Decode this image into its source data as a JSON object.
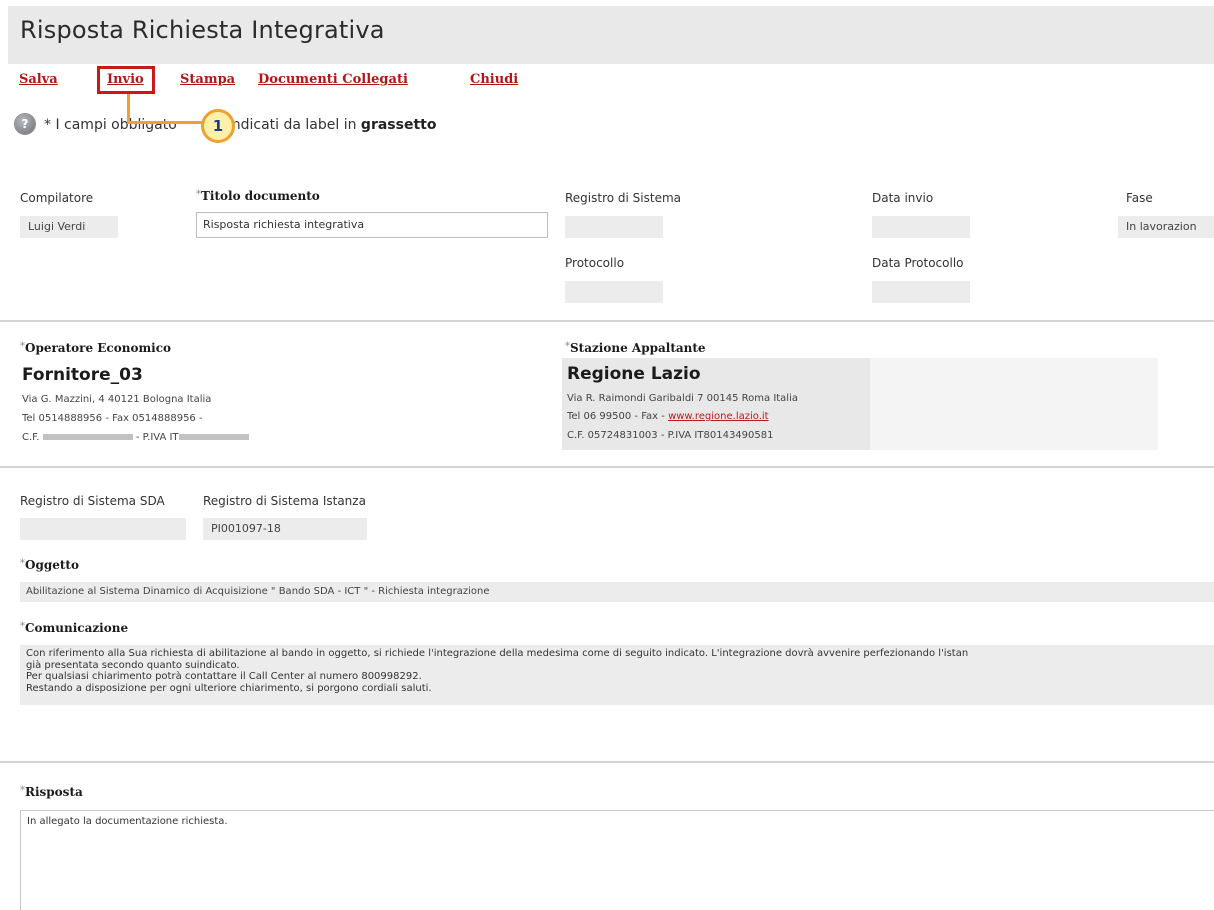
{
  "header": {
    "title": "Risposta Richiesta Integrativa"
  },
  "toolbar": {
    "salva": "Salva",
    "invio": "Invio",
    "stampa": "Stampa",
    "documenti_collegati": "Documenti Collegati",
    "chiudi": "Chiudi"
  },
  "callout": {
    "number": "1"
  },
  "help": {
    "icon": "?"
  },
  "note": {
    "prefix": "* I campi obbligato",
    "hidden_part": "",
    "suffix": "o indicati da label in",
    "bold": "grassetto"
  },
  "fields": {
    "compilatore_label": "Compilatore",
    "compilatore_value": "Luigi Verdi",
    "titolo_label": "Titolo documento",
    "titolo_value": "Risposta richiesta integrativa",
    "registro_label": "Registro di Sistema",
    "registro_value": "",
    "data_invio_label": "Data invio",
    "data_invio_value": "",
    "fase_label": "Fase",
    "fase_value": "In lavorazion",
    "protocollo_label": "Protocollo",
    "protocollo_value": "",
    "data_protocollo_label": "Data Protocollo",
    "data_protocollo_value": ""
  },
  "operatore": {
    "label": "Operatore Economico",
    "name": "Fornitore_03",
    "address": "Via G. Mazzini, 4 40121 Bologna Italia",
    "phone": "Tel 0514888956 - Fax 0514888956 -",
    "cf_prefix": "C.F.",
    "piva_prefix": "- P.IVA IT"
  },
  "stazione": {
    "label": "Stazione Appaltante",
    "name": "Regione Lazio",
    "address": "Via R. Raimondi Garibaldi 7 00145 Roma Italia",
    "phone": "Tel 06 99500 - Fax -",
    "website": "www.regione.lazio.it",
    "cf_piva": "C.F. 05724831003 - P.IVA IT80143490581"
  },
  "registri": {
    "sda_label": "Registro di Sistema SDA",
    "sda_value": "",
    "istanza_label": "Registro di Sistema Istanza",
    "istanza_value": "PI001097-18"
  },
  "oggetto": {
    "label": "Oggetto",
    "value": "Abilitazione al Sistema Dinamico di Acquisizione \" Bando SDA - ICT \" - Richiesta integrazione"
  },
  "comunicazione": {
    "label": "Comunicazione",
    "lines": [
      "Con riferimento alla Sua richiesta di abilitazione al bando in oggetto, si richiede l'integrazione della medesima come di seguito indicato. L'integrazione dovrà avvenire perfezionando l'istan",
      "già presentata secondo quanto suindicato.",
      "Per qualsiasi chiarimento potrà contattare il Call Center al numero 800998292.",
      "Restando a disposizione per ogni ulteriore chiarimento, si porgono cordiali saluti."
    ]
  },
  "risposta": {
    "label": "Risposta",
    "value": "In allegato la documentazione richiesta."
  }
}
